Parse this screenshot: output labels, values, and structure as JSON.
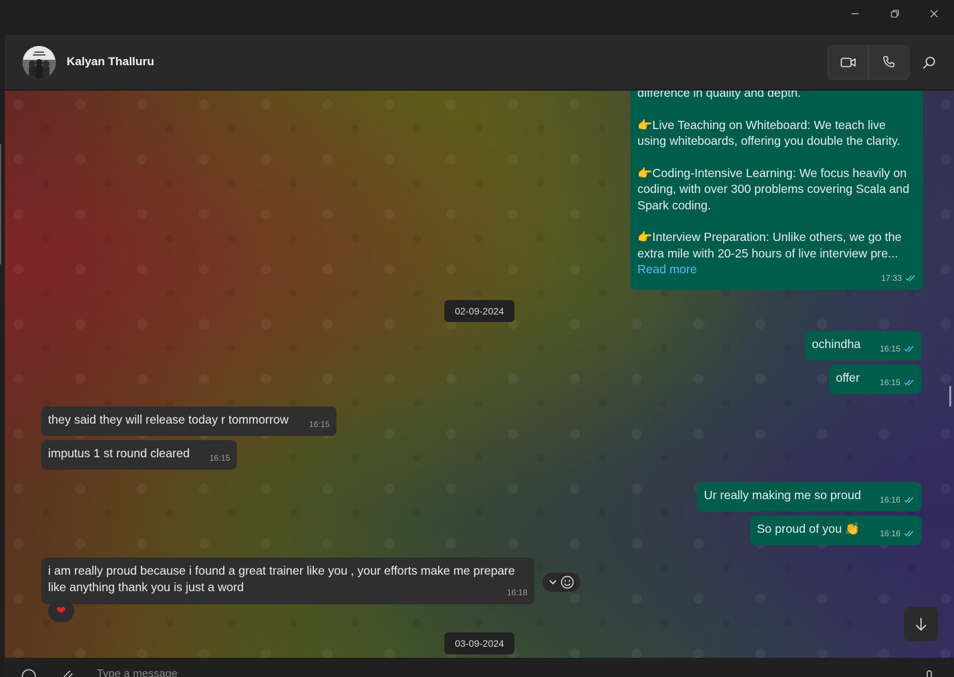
{
  "window": {
    "controls": [
      "minimize-icon",
      "restore-icon",
      "close-icon"
    ]
  },
  "header": {
    "contact_name": "Kalyan Thalluru",
    "avatar": "avatar-photo",
    "actions": [
      "video-call-icon",
      "voice-call-icon",
      "search-icon"
    ]
  },
  "messages": {
    "long": {
      "line0": "difference in quality and depth.",
      "para1": "👉Live Teaching on Whiteboard: We teach live using whiteboards, offering you double the clarity.",
      "para2": "👉Coding-Intensive Learning: We focus heavily on coding, with over 300 problems covering Scala and Spark coding.",
      "para3": "👉Interview Preparation: Unlike others, we go the extra mile with 20-25 hours of live interview pre...",
      "read_more": "Read more",
      "time": "17:33"
    },
    "date1": "02-09-2024",
    "m1": {
      "text": "ochindha",
      "time": "16:15"
    },
    "m2": {
      "text": "offer",
      "time": "16:15"
    },
    "m3": {
      "text": "they said they will release today r tommorrow",
      "time": "16:15"
    },
    "m4": {
      "text": "imputus 1 st round cleared",
      "time": "16:15"
    },
    "m5": {
      "text": "Ur really making me so proud",
      "time": "16:16"
    },
    "m6": {
      "text": "So proud of you 👏",
      "time": "16:16"
    },
    "m7": {
      "text": "i am really proud  because i found a great trainer like you , your efforts make me prepare like anything thank you is just a word",
      "time": "16:18",
      "reaction": "❤"
    },
    "date2": "03-09-2024"
  },
  "composer": {
    "placeholder": "Type a message",
    "icons": [
      "emoji-icon",
      "attach-icon",
      "mic-icon"
    ]
  },
  "colors": {
    "outgoing_bubble": "#005c4b",
    "incoming_bubble": "#2f2f2f",
    "read_ticks": "#53bdeb",
    "link": "#53bdeb"
  }
}
